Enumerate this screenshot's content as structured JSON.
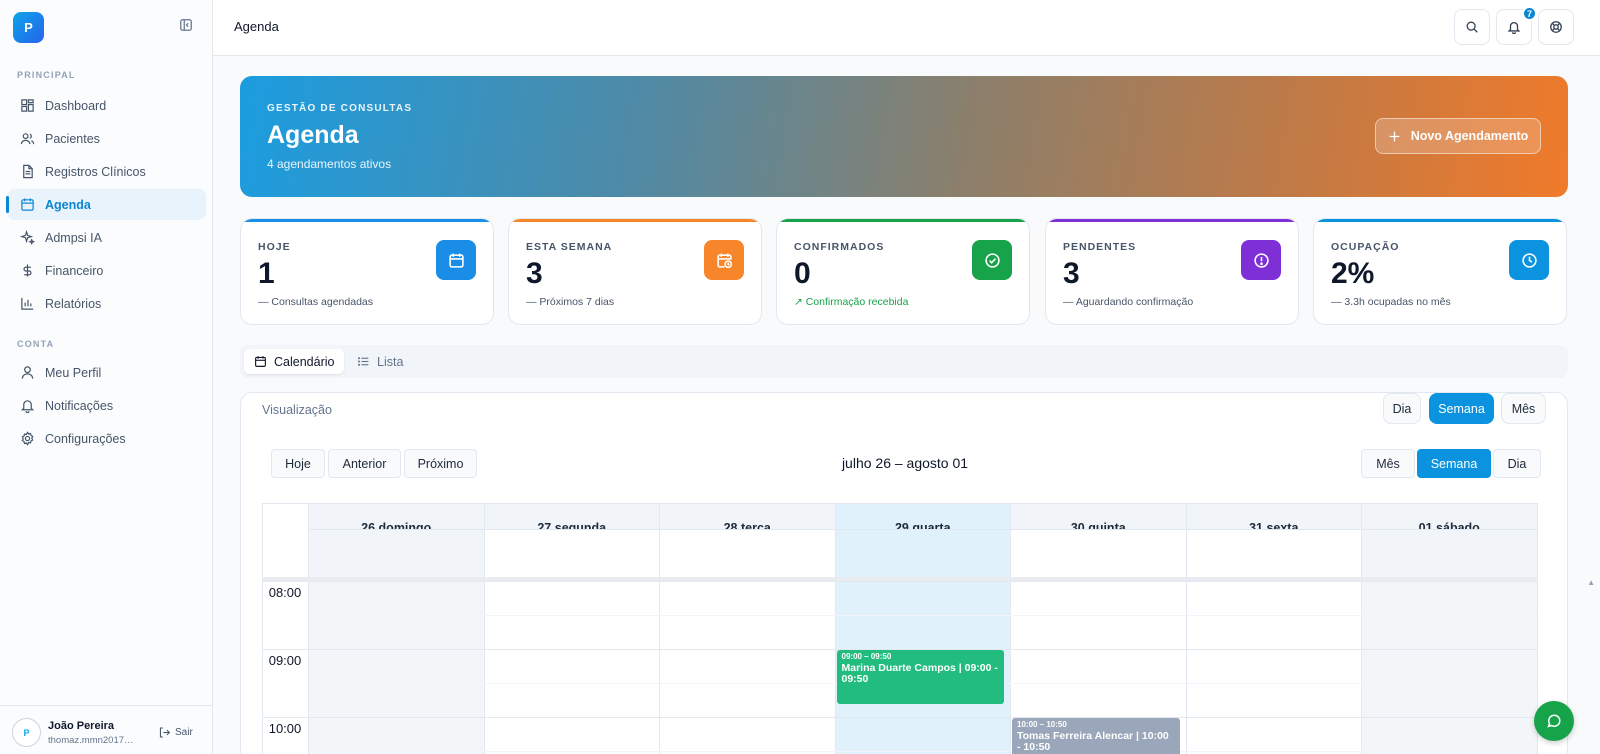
{
  "sidebar": {
    "logo_text": "P",
    "section_principal": "PRINCIPAL",
    "section_conta": "CONTA",
    "items": [
      {
        "label": "Dashboard",
        "icon": "dashboard-icon"
      },
      {
        "label": "Pacientes",
        "icon": "users-icon"
      },
      {
        "label": "Registros Clínicos",
        "icon": "file-icon"
      },
      {
        "label": "Agenda",
        "icon": "calendar-icon",
        "active": true
      },
      {
        "label": "Admpsi IA",
        "icon": "sparkles-icon"
      },
      {
        "label": "Financeiro",
        "icon": "dollar-icon"
      },
      {
        "label": "Relatórios",
        "icon": "bar-chart-icon"
      }
    ],
    "account_items": [
      {
        "label": "Meu Perfil",
        "icon": "user-icon"
      },
      {
        "label": "Notificações",
        "icon": "bell-icon"
      },
      {
        "label": "Configurações",
        "icon": "gear-icon"
      }
    ],
    "user": {
      "name": "João Pereira",
      "email": "thomaz.mmn2017@g...",
      "logout": "Sair"
    }
  },
  "topbar": {
    "title": "Agenda",
    "notification_count": "7"
  },
  "hero": {
    "eyebrow": "GESTÃO DE CONSULTAS",
    "title": "Agenda",
    "subtitle": "4 agendamentos ativos",
    "button": "Novo Agendamento"
  },
  "stats": [
    {
      "label": "HOJE",
      "value": "1",
      "desc": "— Consultas agendadas",
      "color": "#1a8ee6",
      "icon": "calendar-icon"
    },
    {
      "label": "ESTA SEMANA",
      "value": "3",
      "desc": "— Próximos 7 dias",
      "color": "#f7862a",
      "icon": "calendar-clock-icon"
    },
    {
      "label": "CONFIRMADOS",
      "value": "0",
      "desc": "↗ Confirmação recebida",
      "color": "#16a34a",
      "icon": "check-circle-icon"
    },
    {
      "label": "PENDENTES",
      "value": "3",
      "desc": "— Aguardando confirmação",
      "color": "#7e2fd6",
      "icon": "alert-circle-icon"
    },
    {
      "label": "OCUPAÇÃO",
      "value": "2%",
      "desc": "— 3.3h ocupadas no mês",
      "color": "#0b93df",
      "icon": "clock-icon"
    }
  ],
  "tabs": [
    {
      "label": "Calendário",
      "active": true
    },
    {
      "label": "Lista",
      "active": false
    }
  ],
  "panel": {
    "label": "Visualização",
    "view_buttons": [
      "Dia",
      "Semana",
      "Mês"
    ],
    "active_view": "Semana"
  },
  "calendar": {
    "nav_buttons": [
      "Hoje",
      "Anterior",
      "Próximo"
    ],
    "title": "julho 26 – agosto 01",
    "view_buttons": [
      "Mês",
      "Semana",
      "Dia"
    ],
    "active_view": "Semana",
    "days": [
      "26 domingo",
      "27 segunda",
      "28 terça",
      "29 quarta",
      "30 quinta",
      "31 sexta",
      "01 sábado"
    ],
    "today_index": 3,
    "times": [
      "08:00",
      "09:00",
      "10:00"
    ],
    "events": [
      {
        "day": 3,
        "time": "09:00 – 09:50",
        "title": "Marina Duarte Campos | 09:00 - 09:50",
        "color": "#22bd7e",
        "start_hour": 9.0,
        "end_hour": 9.83
      },
      {
        "day": 4,
        "time": "10:00 – 10:50",
        "title": "Tomas Ferreira Alencar | 10:00 - 10:50",
        "color": "#9aa6ba",
        "start_hour": 10.0,
        "end_hour": 10.83
      }
    ]
  }
}
